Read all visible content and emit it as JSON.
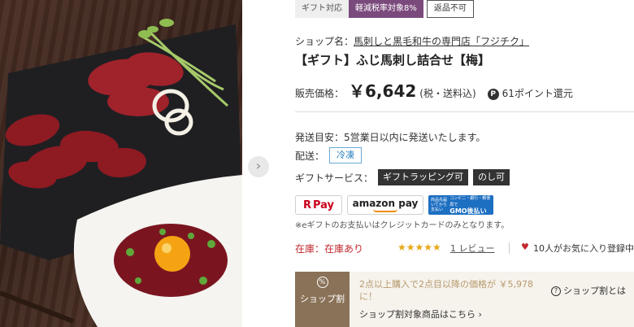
{
  "tags": {
    "gift": "ギフト対応",
    "tax": "軽減税率対象8%",
    "no_return": "返品不可"
  },
  "shop": {
    "label": "ショップ名：",
    "name": "馬刺しと黒毛和牛の専門店「フジチク」"
  },
  "product": {
    "title": "【ギフト】ふじ馬刺し詰合せ【梅】",
    "price_label": "販売価格：",
    "price": "￥6,642",
    "price_note": "(税・送料込)",
    "point_badge": "P",
    "points": "61ポイント還元"
  },
  "shipping": {
    "estimate": "発送目安：5営業日以内に発送いたします。",
    "delivery_label": "配送：",
    "delivery_value": "冷凍",
    "gift_label": "ギフトサービス：",
    "gift_options": [
      "ギフトラッピング可",
      "のし可"
    ]
  },
  "payments": {
    "rpay_r": "R",
    "rpay": "Pay",
    "amazon": "amazon pay",
    "gmo_left": "商品先届いてから支払い",
    "gmo_small": "コンビニ・銀行・郵便局で",
    "gmo_big": "GMO後払い",
    "note": "※eギフトのお支払いはクレジットカードのみとなります。"
  },
  "status": {
    "stock": "在庫：在庫あり",
    "stars": "★★★★★",
    "reviews": "1 レビュー",
    "favorites": "10人がお気に入り登録中"
  },
  "bundle": {
    "badge_icon": "%",
    "badge_label": "ショップ割",
    "text": "2点以上購入で2点目以降の価格が ￥5,978に！",
    "link": "ショップ割対象商品はこちら ›",
    "help": "ショップ割とは"
  },
  "icons": {
    "prev_arrow": "chevron-right-icon",
    "heart": "heart-icon",
    "help": "question-circle-icon"
  },
  "colors": {
    "tax_tag": "#7b4a7d",
    "stock": "#c0272d",
    "stars": "#e6a817",
    "bundle_badge": "#8a7258",
    "rpay": "#c9001a"
  }
}
